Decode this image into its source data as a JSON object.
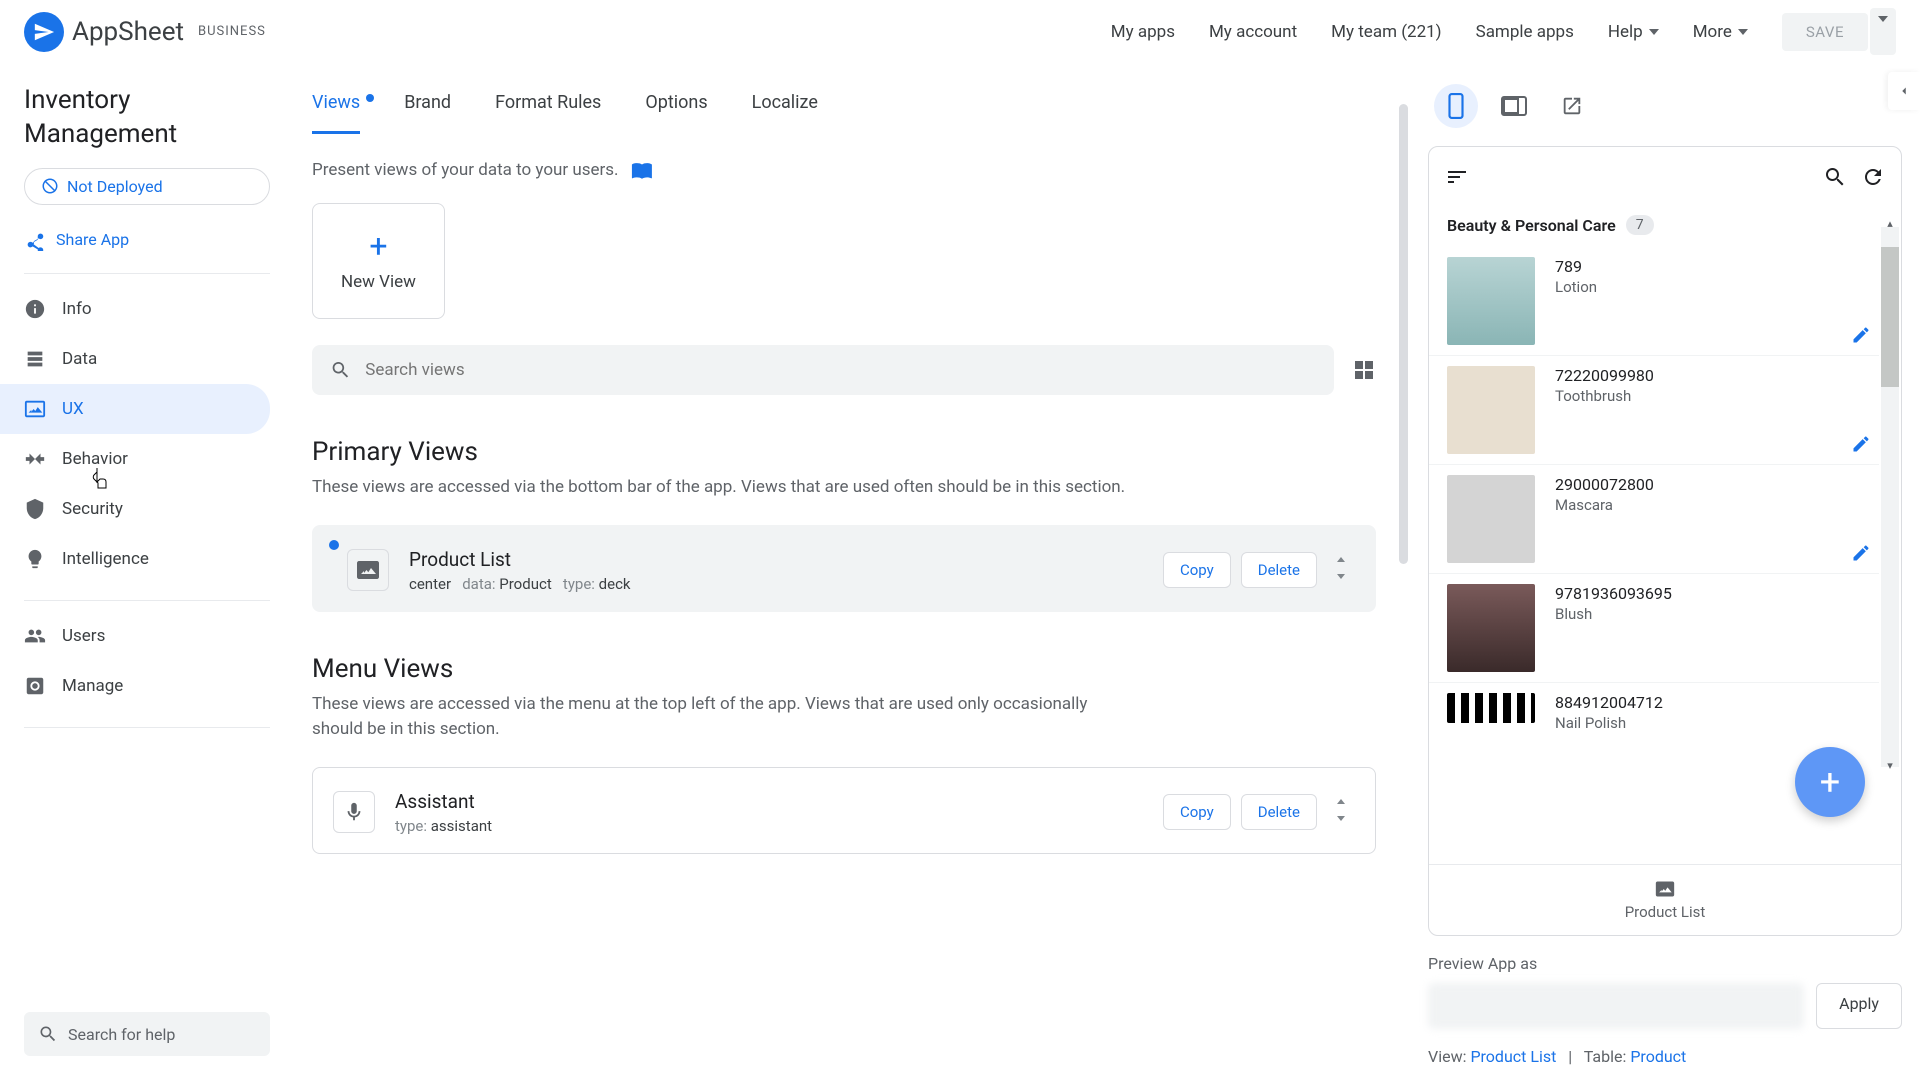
{
  "header": {
    "brand": "AppSheet",
    "plan_badge": "BUSINESS",
    "nav": {
      "my_apps": "My apps",
      "my_account": "My account",
      "my_team": "My team (221)",
      "sample_apps": "Sample apps",
      "help": "Help",
      "more": "More"
    },
    "save": "SAVE"
  },
  "sidebar": {
    "app_title": "Inventory Management",
    "deploy_pill": "Not Deployed",
    "share": "Share App",
    "items": {
      "info": "Info",
      "data": "Data",
      "ux": "UX",
      "behavior": "Behavior",
      "security": "Security",
      "intelligence": "Intelligence",
      "users": "Users",
      "manage": "Manage"
    },
    "help_search_placeholder": "Search for help"
  },
  "tabs": {
    "views": "Views",
    "brand": "Brand",
    "format_rules": "Format Rules",
    "options": "Options",
    "localize": "Localize"
  },
  "content": {
    "hint": "Present views of your data to your users.",
    "new_view": "New View",
    "search_placeholder": "Search views",
    "primary": {
      "title": "Primary Views",
      "desc": "These views are accessed via the bottom bar of the app. Views that are used often should be in this section.",
      "card": {
        "title": "Product List",
        "position_label": "center",
        "data_label": "data:",
        "data_value": "Product",
        "type_label": "type:",
        "type_value": "deck",
        "copy": "Copy",
        "delete": "Delete"
      }
    },
    "menu": {
      "title": "Menu Views",
      "desc": "These views are accessed via the menu at the top left of the app. Views that are used only occasionally should be in this section.",
      "card": {
        "title": "Assistant",
        "type_label": "type:",
        "type_value": "assistant",
        "copy": "Copy",
        "delete": "Delete"
      }
    }
  },
  "preview": {
    "category": "Beauty & Personal Care",
    "category_count": "7",
    "products": [
      {
        "id": "789",
        "name": "Lotion"
      },
      {
        "id": "72220099980",
        "name": "Toothbrush"
      },
      {
        "id": "29000072800",
        "name": "Mascara"
      },
      {
        "id": "9781936093695",
        "name": "Blush"
      },
      {
        "id": "884912004712",
        "name": "Nail Polish"
      }
    ],
    "bottom_label": "Product List",
    "preview_as_label": "Preview App as",
    "apply": "Apply",
    "view_label": "View:",
    "view_value": "Product List",
    "table_label": "Table:",
    "table_value": "Product"
  }
}
